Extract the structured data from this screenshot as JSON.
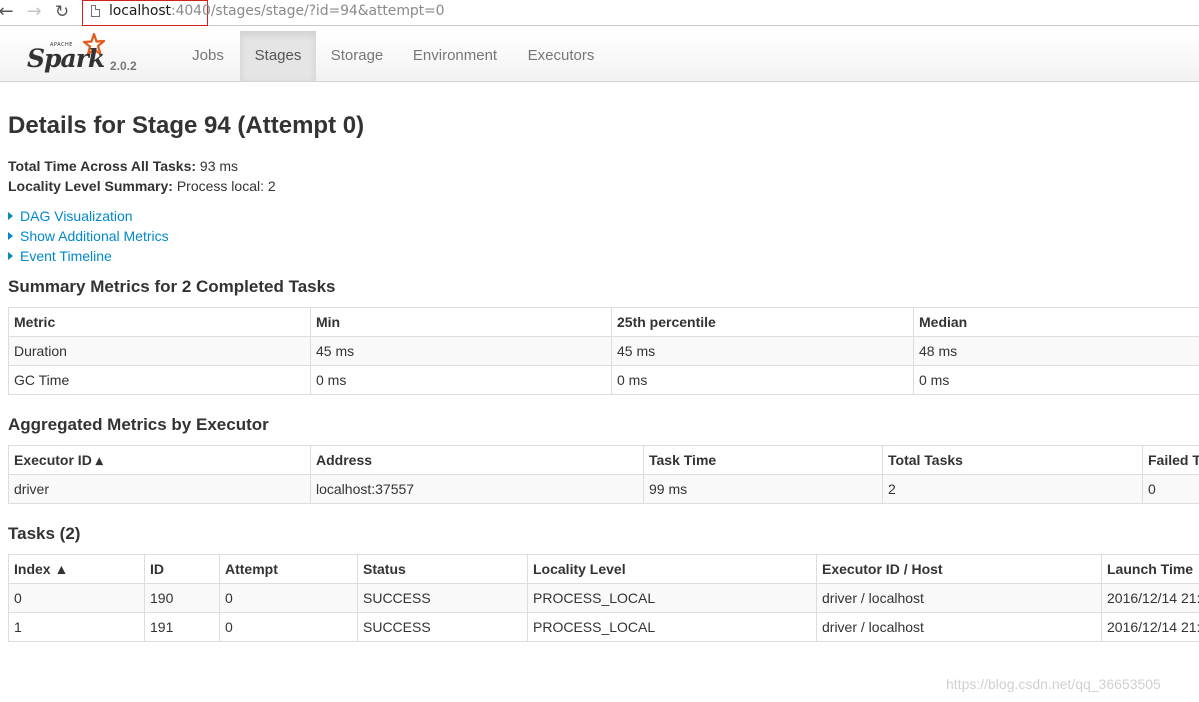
{
  "browser": {
    "url_host": "localhost",
    "url_port": ":4040",
    "url_path": "/stages/stage/?id=94&attempt=0"
  },
  "navbar": {
    "brand_apache": "APACHE",
    "brand_name": "Spark",
    "version": "2.0.2",
    "tabs": [
      {
        "label": "Jobs",
        "active": false
      },
      {
        "label": "Stages",
        "active": true
      },
      {
        "label": "Storage",
        "active": false
      },
      {
        "label": "Environment",
        "active": false
      },
      {
        "label": "Executors",
        "active": false
      }
    ]
  },
  "page": {
    "title": "Details for Stage 94 (Attempt 0)",
    "total_time_label": "Total Time Across All Tasks:",
    "total_time_value": "93 ms",
    "locality_label": "Locality Level Summary:",
    "locality_value": "Process local: 2",
    "expanders": [
      "DAG Visualization",
      "Show Additional Metrics",
      "Event Timeline"
    ]
  },
  "summary_metrics": {
    "title": "Summary Metrics for 2 Completed Tasks",
    "headers": [
      "Metric",
      "Min",
      "25th percentile",
      "Median"
    ],
    "rows": [
      [
        "Duration",
        "45 ms",
        "45 ms",
        "48 ms"
      ],
      [
        "GC Time",
        "0 ms",
        "0 ms",
        "0 ms"
      ]
    ]
  },
  "executor_metrics": {
    "title": "Aggregated Metrics by Executor",
    "headers": [
      "Executor ID ▴",
      "Address",
      "Task Time",
      "Total Tasks",
      "Failed T"
    ],
    "rows": [
      [
        "driver",
        "localhost:37557",
        "99 ms",
        "2",
        "0"
      ]
    ]
  },
  "tasks": {
    "title": "Tasks (2)",
    "headers": [
      "Index ▲",
      "ID",
      "Attempt",
      "Status",
      "Locality Level",
      "Executor ID / Host",
      "Launch Time"
    ],
    "rows": [
      [
        "0",
        "190",
        "0",
        "SUCCESS",
        "PROCESS_LOCAL",
        "driver / localhost",
        "2016/12/14 21:"
      ],
      [
        "1",
        "191",
        "0",
        "SUCCESS",
        "PROCESS_LOCAL",
        "driver / localhost",
        "2016/12/14 21:"
      ]
    ]
  },
  "watermark": "https://blog.csdn.net/qq_36653505",
  "colors": {
    "link": "#0088cc",
    "url_highlight_border": "#d0211c",
    "spark_star": "#e25a1c"
  }
}
